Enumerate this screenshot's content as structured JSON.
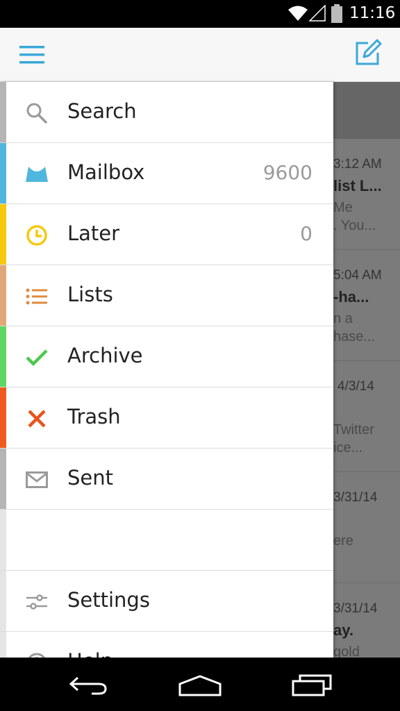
{
  "status_bar": {
    "time": "11:16",
    "icons": [
      "wifi-icon",
      "signal-icon",
      "battery-icon"
    ]
  },
  "app_bar": {
    "menu_icon": "hamburger-menu-icon",
    "compose_icon": "compose-icon",
    "accent_color": "#3aa8d8"
  },
  "drawer": {
    "items": [
      {
        "label": "Search",
        "count": "",
        "icon": "search-icon",
        "stripe_color": "#b5b5b5"
      },
      {
        "label": "Mailbox",
        "count": "9600",
        "icon": "mailbox-icon",
        "stripe_color": "#4fb7dd"
      },
      {
        "label": "Later",
        "count": "0",
        "icon": "clock-icon",
        "stripe_color": "#f6c90e"
      },
      {
        "label": "Lists",
        "count": "",
        "icon": "list-icon",
        "stripe_color": "#e0a878"
      },
      {
        "label": "Archive",
        "count": "",
        "icon": "checkmark-icon",
        "stripe_color": "#5fd65f"
      },
      {
        "label": "Trash",
        "count": "",
        "icon": "x-icon",
        "stripe_color": "#f05a1e"
      },
      {
        "label": "Sent",
        "count": "",
        "icon": "envelope-icon",
        "stripe_color": "#b5b5b5"
      },
      {
        "label": "",
        "count": "",
        "icon": "",
        "stripe_color": "#e5e5e5"
      },
      {
        "label": "Settings",
        "count": "",
        "icon": "sliders-icon",
        "stripe_color": "#e5e5e5"
      },
      {
        "label": "Help",
        "count": "",
        "icon": "info-icon",
        "stripe_color": "#e5e5e5"
      }
    ]
  },
  "background_list": {
    "items": [
      {
        "date": "3:12 AM",
        "title": "list L...",
        "preview1": "Me",
        "preview2": ". You..."
      },
      {
        "date": "5:04 AM",
        "title": "-ha...",
        "preview1": "n a",
        "preview2": "hase..."
      },
      {
        "date": "4/3/14",
        "title": "",
        "preview1": "Twitter",
        "preview2": "ice..."
      },
      {
        "date": "3/31/14",
        "title": "",
        "preview1": "ere",
        "preview2": ""
      },
      {
        "date": "3/31/14",
        "title": "ay.",
        "preview1": "gold",
        "preview2": ""
      }
    ]
  },
  "nav_bar": {
    "buttons": [
      "back-icon",
      "home-icon",
      "recents-icon"
    ]
  }
}
